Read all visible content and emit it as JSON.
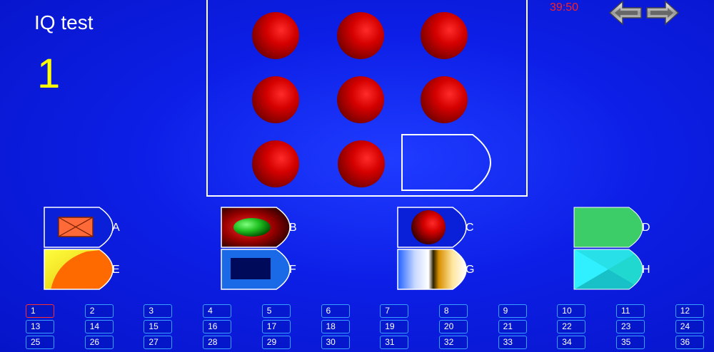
{
  "header": {
    "title": "IQ test",
    "question_number": "1",
    "timer": "39:50"
  },
  "navigation": {
    "prev_icon": "arrow-left-icon",
    "next_icon": "arrow-right-icon"
  },
  "options": [
    {
      "letter": "A"
    },
    {
      "letter": "B"
    },
    {
      "letter": "C"
    },
    {
      "letter": "D"
    },
    {
      "letter": "E"
    },
    {
      "letter": "F"
    },
    {
      "letter": "G"
    },
    {
      "letter": "H"
    }
  ],
  "question_grid": {
    "current": "1",
    "visible_numbers": [
      "1",
      "2",
      "3",
      "4",
      "5",
      "6",
      "7",
      "8",
      "9",
      "10",
      "11",
      "12",
      "13",
      "14",
      "15",
      "16",
      "17",
      "18",
      "19",
      "20",
      "21",
      "22",
      "23",
      "24",
      "25",
      "26",
      "27",
      "28",
      "29",
      "30",
      "31",
      "32",
      "33",
      "34",
      "35",
      "36"
    ]
  },
  "colors": {
    "background": "#0d1fe6",
    "sphere": "#d40000",
    "title": "#ffffff",
    "question_number": "#ffff00",
    "timer": "#ff2020",
    "grid_border": "#3aa0ff",
    "grid_current_border": "#ff3030"
  }
}
